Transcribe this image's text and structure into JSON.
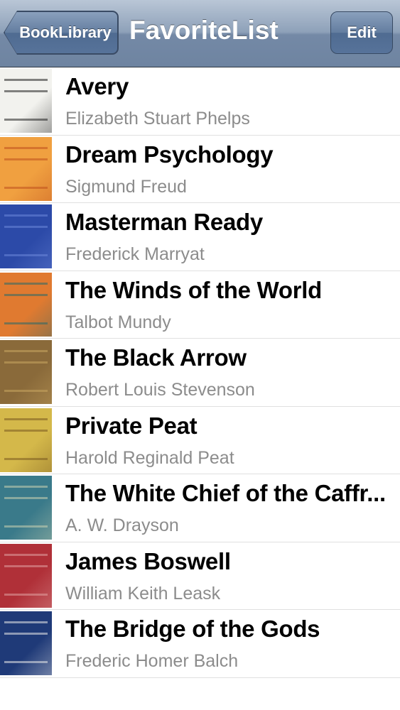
{
  "nav": {
    "back_label": "BookLibrary",
    "title": "FavoriteList",
    "edit_label": "Edit"
  },
  "books": [
    {
      "title": "Avery",
      "author": "Elizabeth Stuart Phelps",
      "cover_color": "#f2f2ee",
      "cover_accent": "#222222"
    },
    {
      "title": "Dream Psychology",
      "author": "Sigmund Freud",
      "cover_color": "#f0a040",
      "cover_accent": "#c0501e"
    },
    {
      "title": "Masterman Ready",
      "author": "Frederick Marryat",
      "cover_color": "#2c4aa8",
      "cover_accent": "#6b86d8"
    },
    {
      "title": "The Winds of the World",
      "author": "Talbot Mundy",
      "cover_color": "#e07a30",
      "cover_accent": "#2a6a6a"
    },
    {
      "title": "The Black Arrow",
      "author": "Robert Louis Stevenson",
      "cover_color": "#8a6a3a",
      "cover_accent": "#c8a560"
    },
    {
      "title": "Private Peat",
      "author": "Harold Reginald Peat",
      "cover_color": "#d4b84a",
      "cover_accent": "#7a5a20"
    },
    {
      "title": "The White Chief of the Caffr...",
      "author": "A. W. Drayson",
      "cover_color": "#3a7a8a",
      "cover_accent": "#c8d0b0"
    },
    {
      "title": "James Boswell",
      "author": "William Keith Leask",
      "cover_color": "#b03038",
      "cover_accent": "#e0a0a0"
    },
    {
      "title": "The Bridge of the Gods",
      "author": "Frederic Homer Balch",
      "cover_color": "#1f3a78",
      "cover_accent": "#e8e8e8"
    }
  ]
}
